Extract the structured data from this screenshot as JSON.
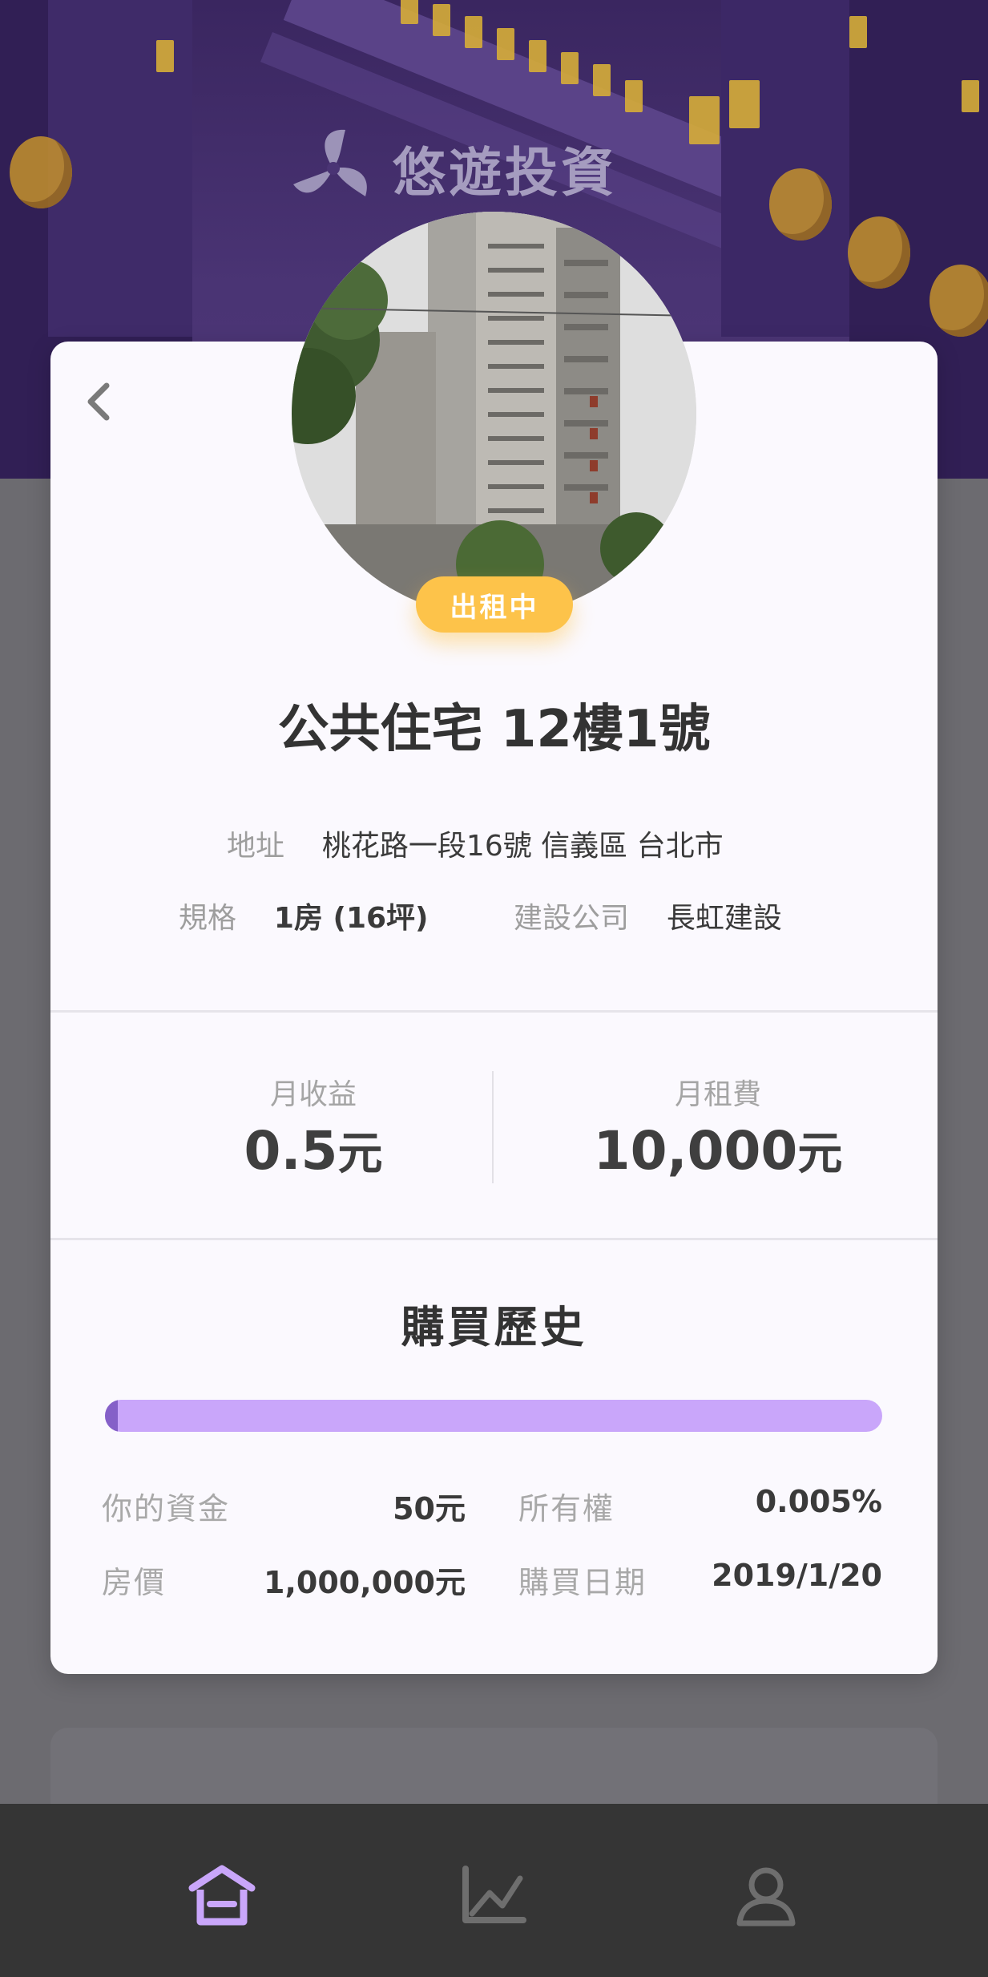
{
  "brand": {
    "name": "悠遊投資"
  },
  "property": {
    "status_badge": "出租中",
    "title": "公共住宅 12樓1號",
    "address_label": "地址",
    "address_value": "桃花路一段16號 信義區 台北市",
    "spec_label": "規格",
    "spec_value": "1房 (16坪)",
    "builder_label": "建設公司",
    "builder_value": "長虹建設"
  },
  "stats": {
    "monthly_income_label": "月收益",
    "monthly_income_value": "0.5",
    "monthly_income_unit": "元",
    "monthly_rent_label": "月租費",
    "monthly_rent_value": "10,000",
    "monthly_rent_unit": "元"
  },
  "history": {
    "title": "購買歷史",
    "ownership_progress": 0.005,
    "your_funds_label": "你的資金",
    "your_funds_value": "50元",
    "ownership_label": "所有權",
    "ownership_value": "0.005%",
    "house_price_label": "房價",
    "house_price_value": "1,000,000元",
    "purchase_date_label": "購買日期",
    "purchase_date_value": "2019/1/20"
  },
  "nav": {
    "items": [
      {
        "icon": "home-icon",
        "active": true
      },
      {
        "icon": "chart-icon",
        "active": false
      },
      {
        "icon": "user-icon",
        "active": false
      }
    ]
  },
  "colors": {
    "accent": "#c9a6fa",
    "accent_dark": "#8560c8",
    "badge": "#fdc34a",
    "header": "#3a2660",
    "nav_bg": "#353535"
  }
}
